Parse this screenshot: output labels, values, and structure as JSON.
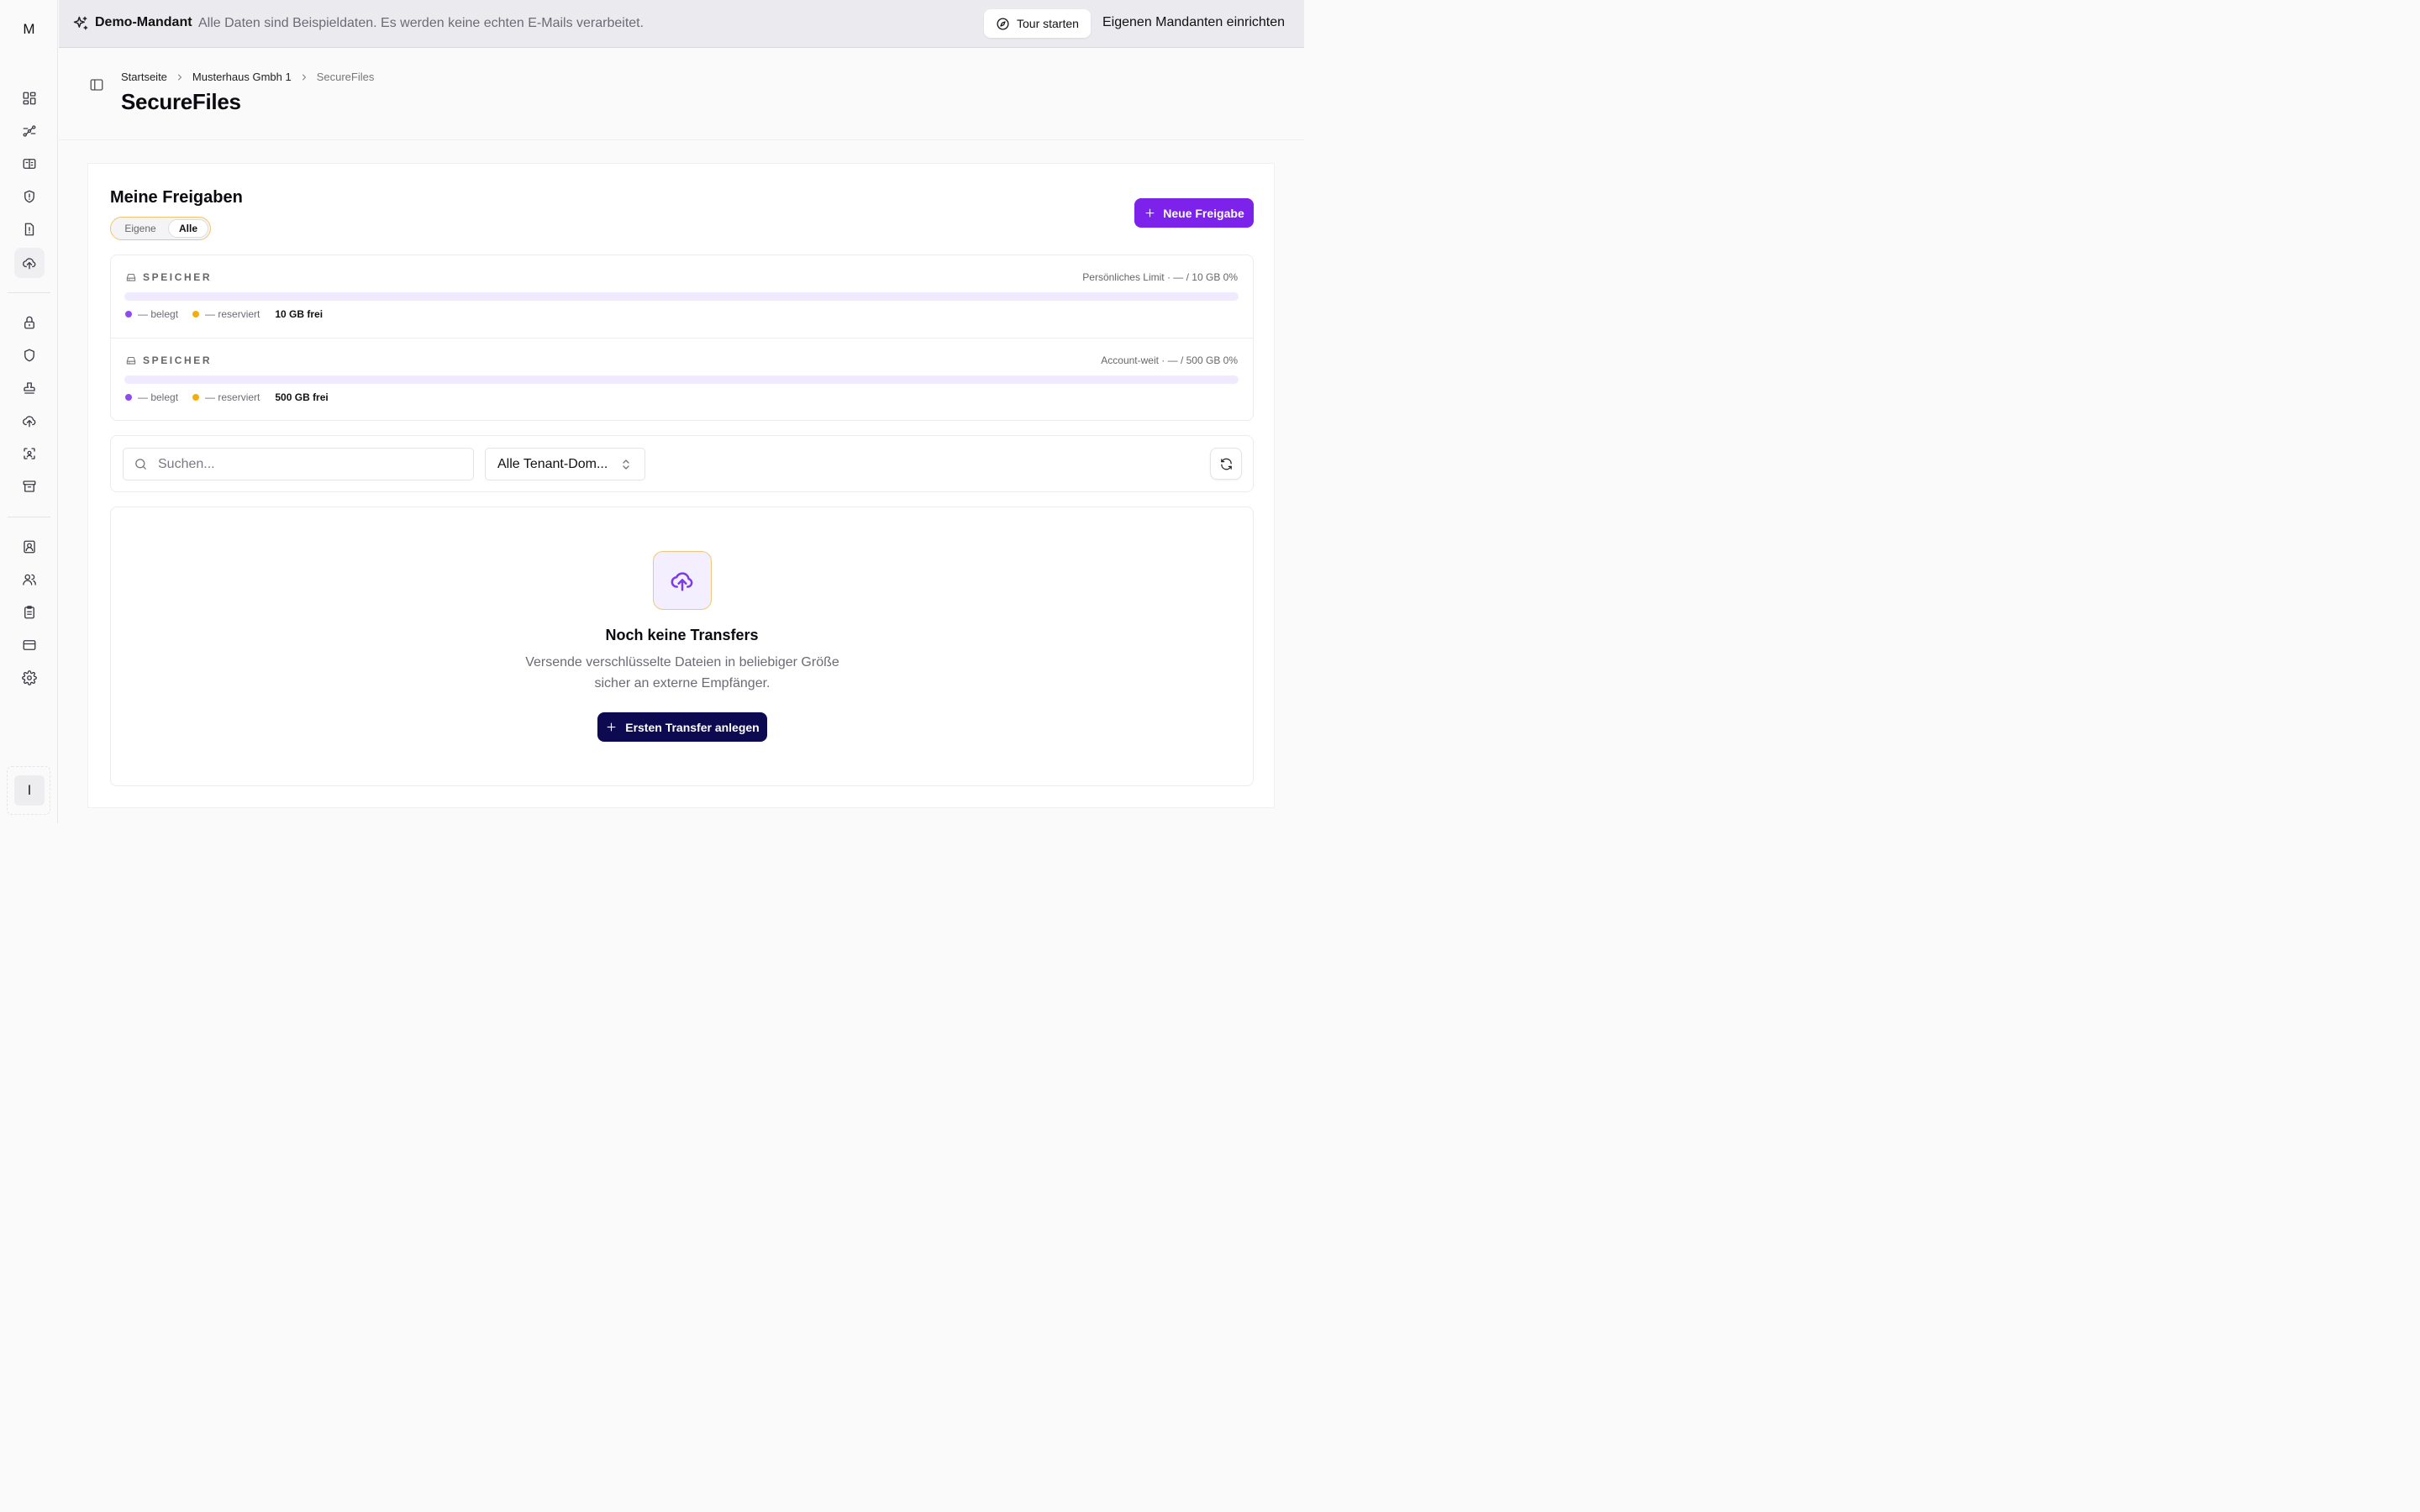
{
  "sidebar": {
    "logo": "M",
    "user_initial": "I",
    "items": [
      {
        "name": "sidebar-item-dashboard",
        "icon": "grid-icon"
      },
      {
        "name": "sidebar-item-routing",
        "icon": "route-icon"
      },
      {
        "name": "sidebar-item-tickets",
        "icon": "ticket-icon"
      },
      {
        "name": "sidebar-item-security-alerts",
        "icon": "shield-alert-icon"
      },
      {
        "name": "sidebar-item-reports",
        "icon": "file-alert-icon"
      },
      {
        "name": "sidebar-item-securefiles",
        "icon": "cloud-upload-icon",
        "active": true
      },
      {
        "name": "sidebar-item-encryption",
        "icon": "lock-icon"
      },
      {
        "name": "sidebar-item-protection",
        "icon": "shield-icon"
      },
      {
        "name": "sidebar-item-signature",
        "icon": "stamp-icon"
      },
      {
        "name": "sidebar-item-upload",
        "icon": "cloud-upload-icon"
      },
      {
        "name": "sidebar-item-scan",
        "icon": "scan-icon"
      },
      {
        "name": "sidebar-item-archive",
        "icon": "archive-icon"
      },
      {
        "name": "sidebar-item-contacts",
        "icon": "contact-icon"
      },
      {
        "name": "sidebar-item-users",
        "icon": "users-icon"
      },
      {
        "name": "sidebar-item-tasks",
        "icon": "clipboard-icon"
      },
      {
        "name": "sidebar-item-billing",
        "icon": "credit-card-icon"
      },
      {
        "name": "sidebar-item-settings",
        "icon": "gear-icon"
      }
    ]
  },
  "banner": {
    "title": "Demo-Mandant",
    "text": "Alle Daten sind Beispieldaten. Es werden keine echten E-Mails verarbeitet.",
    "tour_label": "Tour starten",
    "own_tenant_label": "Eigenen Mandanten einrichten"
  },
  "breadcrumb": {
    "home": "Startseite",
    "tenant": "Musterhaus Gmbh 1",
    "current": "SecureFiles"
  },
  "page_title": "SecureFiles",
  "shares": {
    "title": "Meine Freigaben",
    "filter_options": [
      "Eigene",
      "Alle"
    ],
    "filter_selected": "Alle",
    "new_button_label": "Neue Freigabe"
  },
  "storage": [
    {
      "label": "SPEICHER",
      "limit_text": "Persönliches Limit · — / 10 GB 0%",
      "used_fraction": 0,
      "used_text": "— belegt",
      "reserved_text": "— reserviert",
      "free_text": "10 GB frei"
    },
    {
      "label": "SPEICHER",
      "limit_text": "Account-weit · — / 500 GB 0%",
      "used_fraction": 0,
      "used_text": "— belegt",
      "reserved_text": "— reserviert",
      "free_text": "500 GB frei"
    }
  ],
  "filters": {
    "search_placeholder": "Suchen...",
    "search_value": "",
    "domain_select_value": "Alle Tenant-Dom..."
  },
  "empty_state": {
    "title": "Noch keine Transfers",
    "description": "Versende verschlüsselte Dateien in beliebiger Größe sicher an externe Empfänger.",
    "button_label": "Ersten Transfer anlegen"
  },
  "colors": {
    "accent": "#7c22ea",
    "primary_dark": "#0e0a52",
    "used": "#8b4df0",
    "reserved": "#f1ae0d",
    "segment_border": "#f2c46f"
  }
}
